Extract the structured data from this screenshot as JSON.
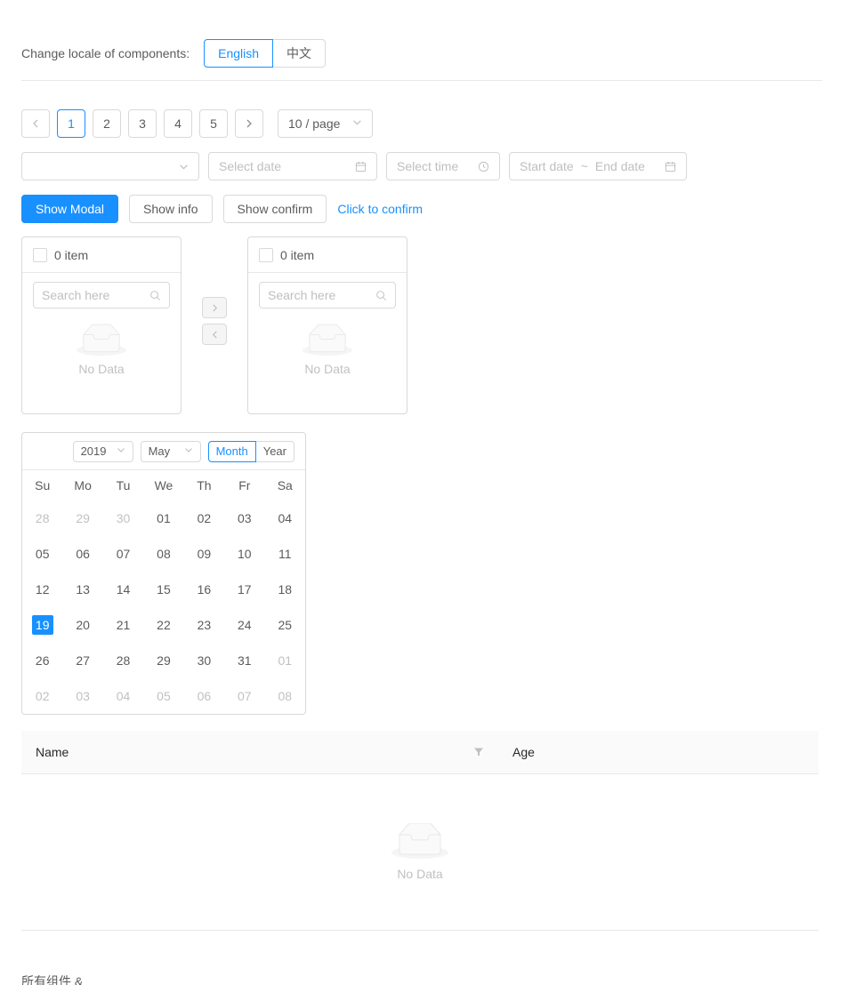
{
  "locale": {
    "label": "Change locale of components:",
    "options": [
      {
        "label": "English",
        "selected": true
      },
      {
        "label": "中文",
        "selected": false
      }
    ]
  },
  "pagination": {
    "prev_icon": "chevron-left-icon",
    "next_icon": "chevron-right-icon",
    "pages": [
      "1",
      "2",
      "3",
      "4",
      "5"
    ],
    "active_page": "1",
    "page_size_label": "10 / page",
    "page_size_icon": "chevron-down-icon"
  },
  "inputs": {
    "select_value": "",
    "select_icon": "chevron-down-icon",
    "date_placeholder": "Select date",
    "date_icon": "calendar-icon",
    "time_placeholder": "Select time",
    "time_icon": "clock-icon",
    "range_start_placeholder": "Start date",
    "range_separator": "~",
    "range_end_placeholder": "End date",
    "range_icon": "calendar-icon"
  },
  "buttons": {
    "show_modal": "Show Modal",
    "show_info": "Show info",
    "show_confirm": "Show confirm",
    "click_to_confirm": "Click to confirm"
  },
  "transfer": {
    "left": {
      "count_label": "0 item",
      "search_placeholder": "Search here",
      "search_icon": "search-icon",
      "empty_text": "No Data"
    },
    "right": {
      "count_label": "0 item",
      "search_placeholder": "Search here",
      "search_icon": "search-icon",
      "empty_text": "No Data"
    },
    "to_right_icon": "chevron-right-icon",
    "to_left_icon": "chevron-left-icon"
  },
  "calendar": {
    "year": "2019",
    "month": "May",
    "mode_month": "Month",
    "mode_year": "Year",
    "selected_mode": "Month",
    "weekdays": [
      "Su",
      "Mo",
      "Tu",
      "We",
      "Th",
      "Fr",
      "Sa"
    ],
    "weeks": [
      [
        {
          "d": "28",
          "dim": true
        },
        {
          "d": "29",
          "dim": true
        },
        {
          "d": "30",
          "dim": true
        },
        {
          "d": "01",
          "dim": false
        },
        {
          "d": "02",
          "dim": false
        },
        {
          "d": "03",
          "dim": false
        },
        {
          "d": "04",
          "dim": false
        }
      ],
      [
        {
          "d": "05",
          "dim": false
        },
        {
          "d": "06",
          "dim": false
        },
        {
          "d": "07",
          "dim": false
        },
        {
          "d": "08",
          "dim": false
        },
        {
          "d": "09",
          "dim": false
        },
        {
          "d": "10",
          "dim": false
        },
        {
          "d": "11",
          "dim": false
        }
      ],
      [
        {
          "d": "12",
          "dim": false
        },
        {
          "d": "13",
          "dim": false
        },
        {
          "d": "14",
          "dim": false
        },
        {
          "d": "15",
          "dim": false
        },
        {
          "d": "16",
          "dim": false
        },
        {
          "d": "17",
          "dim": false
        },
        {
          "d": "18",
          "dim": false
        }
      ],
      [
        {
          "d": "19",
          "dim": false,
          "selected": true
        },
        {
          "d": "20",
          "dim": false
        },
        {
          "d": "21",
          "dim": false
        },
        {
          "d": "22",
          "dim": false
        },
        {
          "d": "23",
          "dim": false
        },
        {
          "d": "24",
          "dim": false
        },
        {
          "d": "25",
          "dim": false
        }
      ],
      [
        {
          "d": "26",
          "dim": false
        },
        {
          "d": "27",
          "dim": false
        },
        {
          "d": "28",
          "dim": false
        },
        {
          "d": "29",
          "dim": false
        },
        {
          "d": "30",
          "dim": false
        },
        {
          "d": "31",
          "dim": false
        },
        {
          "d": "01",
          "dim": true
        }
      ],
      [
        {
          "d": "02",
          "dim": true
        },
        {
          "d": "03",
          "dim": true
        },
        {
          "d": "04",
          "dim": true
        },
        {
          "d": "05",
          "dim": true
        },
        {
          "d": "06",
          "dim": true
        },
        {
          "d": "07",
          "dim": true
        },
        {
          "d": "08",
          "dim": true
        }
      ]
    ]
  },
  "table": {
    "columns": [
      {
        "label": "Name",
        "filter_icon": "filter-icon"
      },
      {
        "label": "Age"
      }
    ],
    "rows": [],
    "empty_text": "No Data"
  },
  "footer": {
    "text": "所有组件 &"
  },
  "colors": {
    "primary": "#1890ff",
    "border": "#d9d9d9",
    "divider": "#e8e8e8",
    "header_bg": "#fafafa",
    "disabled_text": "rgba(0,0,0,0.25)"
  }
}
